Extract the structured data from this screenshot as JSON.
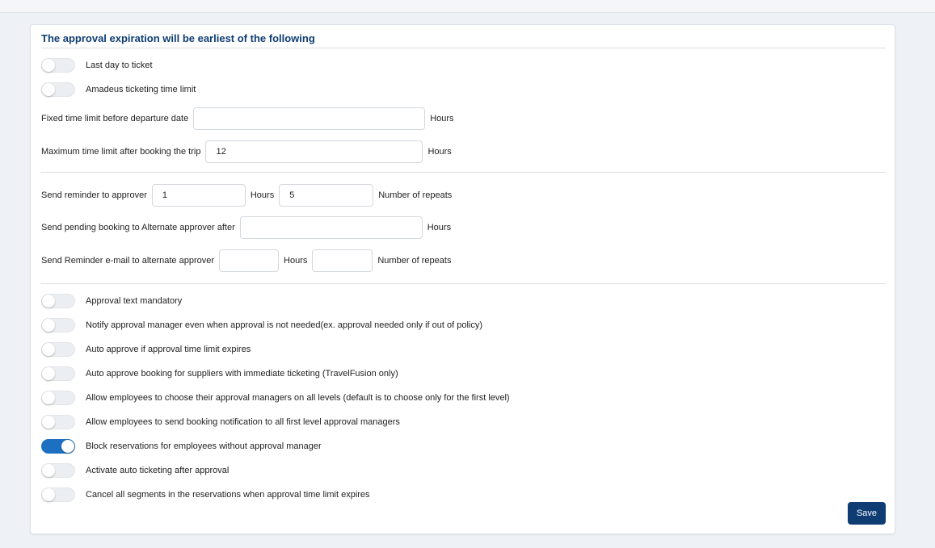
{
  "title": "The approval expiration will be earliest of the following",
  "expiration_toggles": [
    {
      "label": "Last day to ticket",
      "on": false
    },
    {
      "label": "Amadeus ticketing time limit",
      "on": false
    }
  ],
  "fixed_limit": {
    "label": "Fixed time limit before departure date",
    "value": "",
    "unit": "Hours"
  },
  "max_limit": {
    "label": "Maximum time limit after booking the trip",
    "value": "12",
    "unit": "Hours"
  },
  "reminder": {
    "label": "Send reminder to approver",
    "hours_value": "1",
    "hours_unit": "Hours",
    "repeats_value": "5",
    "repeats_unit": "Number of repeats"
  },
  "pending": {
    "label": "Send pending booking to Alternate approver after",
    "value": "",
    "unit": "Hours"
  },
  "alt_reminder": {
    "label": "Send Reminder e-mail to alternate approver",
    "hours_value": "",
    "hours_unit": "Hours",
    "repeats_value": "",
    "repeats_unit": "Number of repeats"
  },
  "option_toggles": [
    {
      "label": "Approval text mandatory",
      "on": false
    },
    {
      "label": "Notify approval manager even when approval is not needed(ex. approval needed only if out of policy)",
      "on": false
    },
    {
      "label": "Auto approve if approval time limit expires",
      "on": false
    },
    {
      "label": "Auto approve booking for suppliers with immediate ticketing (TravelFusion only)",
      "on": false
    },
    {
      "label": "Allow employees to choose their approval managers on all levels (default is to choose only for the first level)",
      "on": false
    },
    {
      "label": "Allow employees to send booking notification to all first level approval managers",
      "on": false
    },
    {
      "label": "Block reservations for employees without approval manager",
      "on": true
    },
    {
      "label": "Activate auto ticketing after approval",
      "on": false
    },
    {
      "label": "Cancel all segments in the reservations when approval time limit expires",
      "on": false
    }
  ],
  "save_label": "Save",
  "colors": {
    "accent": "#1d6fc1",
    "primary": "#0f3d73"
  }
}
